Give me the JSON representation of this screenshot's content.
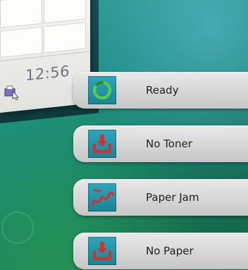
{
  "taskbar": {
    "clock_text": "12:56"
  },
  "status_list": {
    "items": [
      {
        "label": "Ready",
        "icon": "ready-cycle-icon"
      },
      {
        "label": "No Toner",
        "icon": "printer-tray-icon"
      },
      {
        "label": "Paper Jam",
        "icon": "paper-jam-icon"
      },
      {
        "label": "No Paper",
        "icon": "printer-tray-icon"
      }
    ]
  },
  "colors": {
    "icon_background": "#2da7b8",
    "ready_ring": "#5ccf3b",
    "alert_red": "#d9302c",
    "pill_gray": "#d6d6d6"
  }
}
